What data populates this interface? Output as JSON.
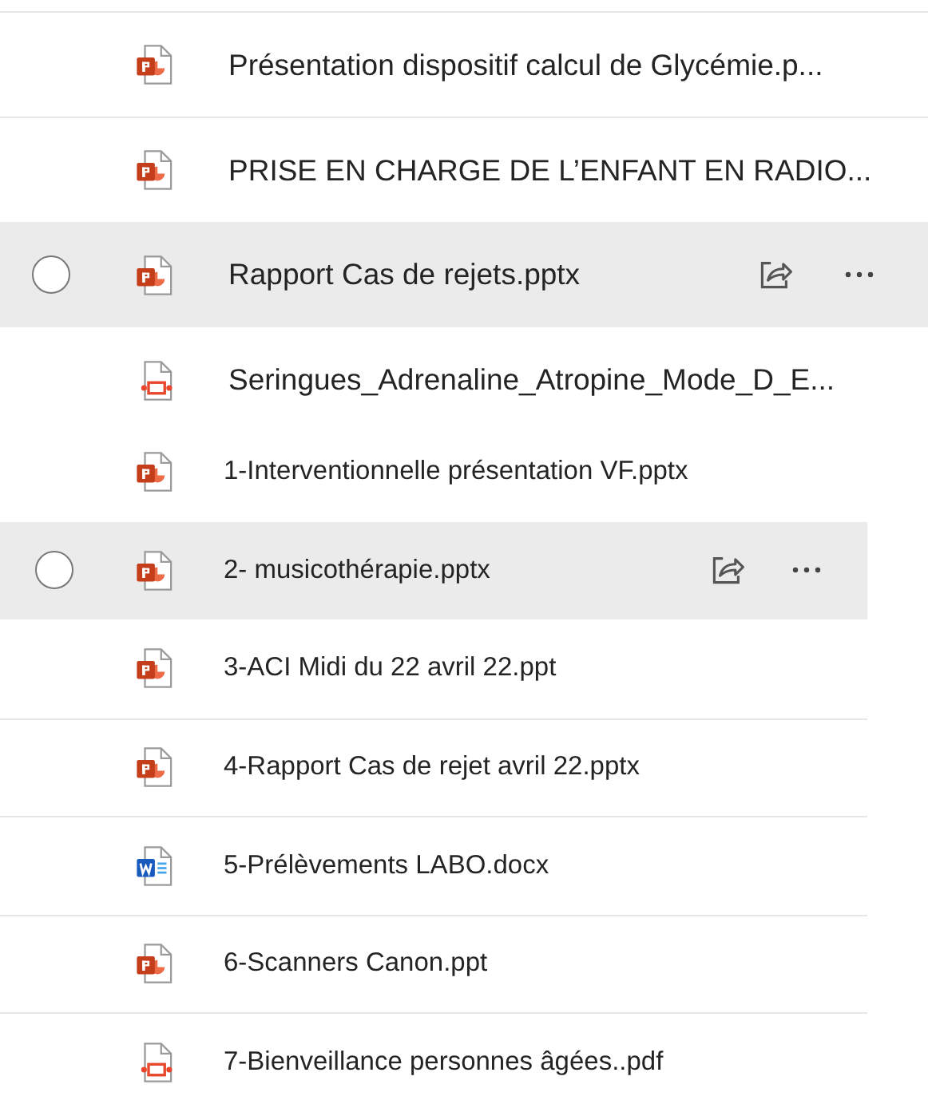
{
  "sections": [
    {
      "rows": [
        {
          "name": "Présentation dispositif calcul de Glycémie.p...",
          "kind": "pptx",
          "hovered": false
        },
        {
          "name": "PRISE EN CHARGE DE L’ENFANT EN RADIO...",
          "kind": "pptx",
          "hovered": false
        },
        {
          "name": "Rapport Cas de rejets.pptx",
          "kind": "pptx",
          "hovered": true
        },
        {
          "name": "Seringues_Adrenaline_Atropine_Mode_D_E...",
          "kind": "pdf",
          "hovered": false
        }
      ]
    },
    {
      "rows": [
        {
          "name": "1-Interventionnelle présentation VF.pptx",
          "kind": "pptx",
          "hovered": false
        },
        {
          "name": "2- musicothérapie.pptx",
          "kind": "pptx",
          "hovered": true
        },
        {
          "name": "3-ACI Midi du 22 avril 22.ppt",
          "kind": "pptx",
          "hovered": false
        },
        {
          "name": "4-Rapport Cas de rejet avril 22.pptx",
          "kind": "pptx",
          "hovered": false
        },
        {
          "name": "5-Prélèvements LABO.docx",
          "kind": "docx",
          "hovered": false
        },
        {
          "name": "6-Scanners Canon.ppt",
          "kind": "pptx",
          "hovered": false
        },
        {
          "name": "7-Bienveillance personnes âgées..pdf",
          "kind": "pdf",
          "hovered": false
        }
      ]
    }
  ]
}
